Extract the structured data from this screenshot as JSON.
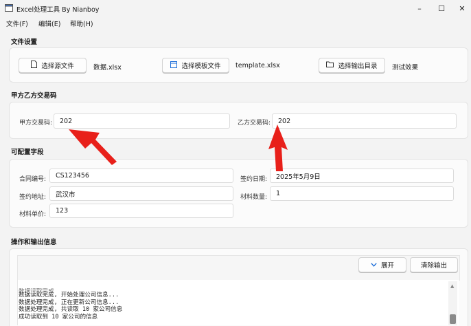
{
  "window": {
    "title": "Excel处理工具 By Nianboy",
    "minimize": "–",
    "maximize": "☐",
    "close": "✕"
  },
  "menu": {
    "items": [
      {
        "label": "文件(F)"
      },
      {
        "label": "编辑(E)"
      },
      {
        "label": "帮助(H)"
      }
    ]
  },
  "file_settings": {
    "title": "文件设置",
    "select_source_label": "选择源文件",
    "source_file": "数据.xlsx",
    "select_template_label": "选择模板文件",
    "template_file": "template.xlsx",
    "select_output_label": "选择输出目录",
    "output_dir": "测试效果"
  },
  "trade_codes": {
    "title": "甲方乙方交易码",
    "party_a_label": "甲方交易码:",
    "party_a_value": "202",
    "party_b_label": "乙方交易码:",
    "party_b_value": "202"
  },
  "config_fields": {
    "title": "可配置字段",
    "contract_no_label": "合同编号:",
    "contract_no_value": "CS123456",
    "sign_date_label": "签约日期:",
    "sign_date_value": "2025年5月9日",
    "sign_place_label": "签约地址:",
    "sign_place_value": "武汉市",
    "quantity_label": "材料数量:",
    "quantity_value": "1",
    "unit_price_label": "材料单价:",
    "unit_price_value": "123"
  },
  "output": {
    "title": "操作和输出信息",
    "expand_label": "展开",
    "clear_label": "清除输出",
    "log_lines": [
      "数据读取完成, 开始处理公司信息...",
      "数据处理完成, 正在更新公司信息...",
      "数据处理完成, 共读取 10 家公司信息",
      "成功读取到 10 家公司的信息"
    ]
  },
  "colors": {
    "accent": "#1e6fd9",
    "arrow": "#e8201a"
  }
}
